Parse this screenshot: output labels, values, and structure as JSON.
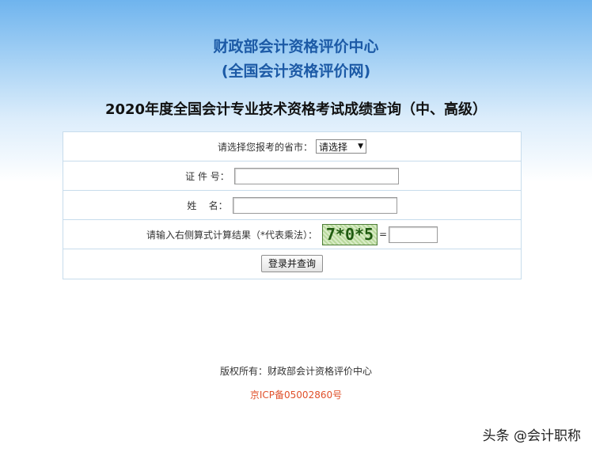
{
  "header": {
    "org_line1": "财政部会计资格评价中心",
    "org_line2": "(全国会计资格评价网)"
  },
  "page_title": "2020年度全国会计专业技术资格考试成绩查询（中、高级）",
  "form": {
    "province_label": "请选择您报考的省市：",
    "province_select_value": "请选择",
    "id_label": "证 件 号：",
    "id_value": "",
    "name_label": "姓    名：",
    "name_value": "",
    "captcha_label": "请输入右侧算式计算结果（*代表乘法）：",
    "captcha_text": "7*0*5",
    "equals": "=",
    "captcha_value": "",
    "submit_label": "登录并查询"
  },
  "footer": {
    "copyright": "版权所有：财政部会计资格评价中心",
    "icp": "京ICP备05002860号"
  },
  "watermark": "头条 @会计职称",
  "colors": {
    "header_text": "#1c5aa6",
    "icp_text": "#e0502a",
    "table_border": "#c7dcec"
  }
}
